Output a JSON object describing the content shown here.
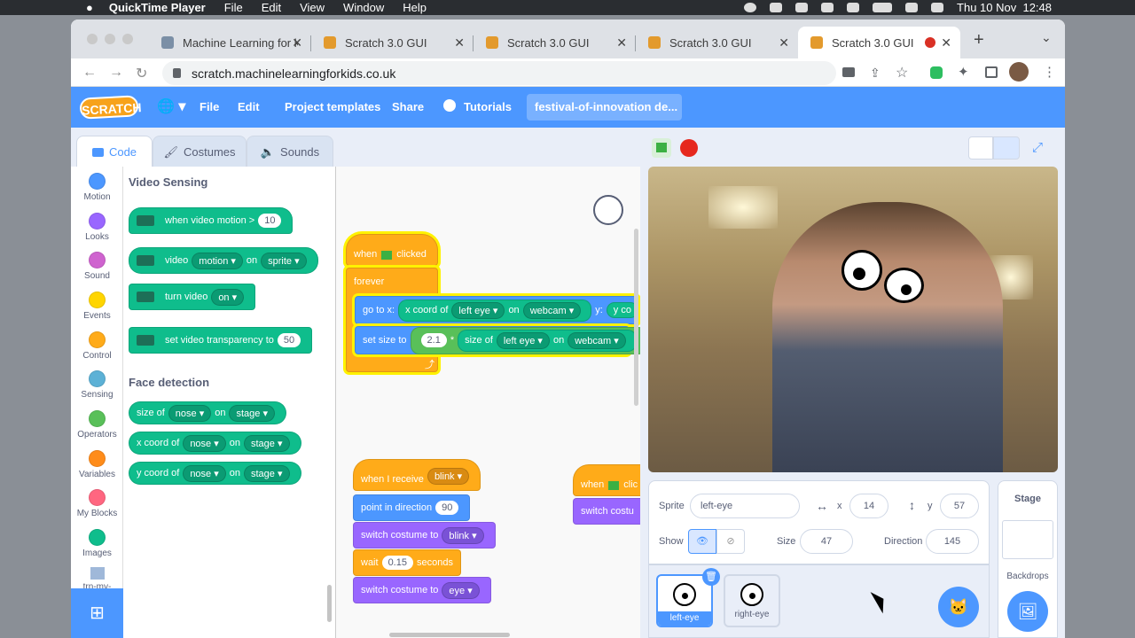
{
  "menubar": {
    "apple": "",
    "app": "QuickTime Player",
    "items": [
      "File",
      "Edit",
      "View",
      "Window",
      "Help"
    ],
    "clock": "Thu 10 Nov  12:48"
  },
  "browser": {
    "tabs": [
      {
        "title": "Machine Learning for k"
      },
      {
        "title": "Scratch 3.0 GUI"
      },
      {
        "title": "Scratch 3.0 GUI"
      },
      {
        "title": "Scratch 3.0 GUI"
      },
      {
        "title": "Scratch 3.0 GUI"
      }
    ],
    "new_tab": "+",
    "tab_menu": "⌄",
    "url": "scratch.machinelearningforkids.co.uk"
  },
  "scratch_menu": {
    "logo": "SCRATCH",
    "globe": "🌐 ▾",
    "file": "File",
    "edit": "Edit",
    "templates": "Project templates",
    "share": "Share",
    "tutorials": "Tutorials",
    "project_title": "festival-of-innovation de..."
  },
  "editor_tabs": {
    "code": "Code",
    "costumes": "Costumes",
    "sounds": "Sounds"
  },
  "categories": [
    {
      "label": "Motion",
      "color": "#4c97ff"
    },
    {
      "label": "Looks",
      "color": "#9966ff"
    },
    {
      "label": "Sound",
      "color": "#cf63cf"
    },
    {
      "label": "Events",
      "color": "#ffd500"
    },
    {
      "label": "Control",
      "color": "#ffab19"
    },
    {
      "label": "Sensing",
      "color": "#5cb1d6"
    },
    {
      "label": "Operators",
      "color": "#59c059"
    },
    {
      "label": "Variables",
      "color": "#ff8c1a"
    },
    {
      "label": "My Blocks",
      "color": "#ff6680"
    },
    {
      "label": "Images",
      "color": "#0fbd8c"
    },
    {
      "label": "trn-my-"
    }
  ],
  "palette": {
    "video_heading": "Video Sensing",
    "face_heading": "Face detection",
    "b1": {
      "text": "when video motion >",
      "value": "10"
    },
    "b2": {
      "text": "video",
      "dd1": "motion ▾",
      "on": "on",
      "dd2": "sprite ▾"
    },
    "b3": {
      "text": "turn video",
      "dd": "on ▾"
    },
    "b4": {
      "text": "set video transparency to",
      "value": "50"
    },
    "f1": {
      "text": "size of",
      "dd1": "nose ▾",
      "on": "on",
      "dd2": "stage ▾"
    },
    "f2": {
      "text": "x coord of",
      "dd1": "nose ▾",
      "on": "on",
      "dd2": "stage ▾"
    },
    "f3": {
      "text": "y coord of",
      "dd1": "nose ▾",
      "on": "on",
      "dd2": "stage ▾"
    }
  },
  "scripts": {
    "s1": {
      "hat": "when",
      "hat2": "clicked",
      "forever": "forever",
      "goto": "go to x:",
      "xcoord": "x coord of",
      "dd_eye": "left eye ▾",
      "on": "on",
      "dd_webcam": "webcam ▾",
      "y": "y:",
      "ycoord": "y co",
      "setsize": "set size to",
      "val": "2.1",
      "times": "*",
      "sizeof": "size of",
      "dd_eye2": "left eye ▾",
      "on2": "on",
      "dd_webcam2": "webcam ▾",
      "loop": "⤴"
    },
    "s2": {
      "hat": "when I receive",
      "dd": "blink ▾",
      "point": "point in direction",
      "dir": "90",
      "switch": "switch costume to",
      "dd2": "blink ▾",
      "wait": "wait",
      "wval": "0.15",
      "seconds": "seconds",
      "switch2": "switch costume to",
      "dd3": "eye ▾"
    },
    "s3": {
      "hat": "when",
      "hat2": "clic",
      "switch": "switch costu"
    }
  },
  "zoom": {
    "in": "+",
    "out": "−",
    "reset": "="
  },
  "sprite_info": {
    "sprite_label": "Sprite",
    "sprite_name": "left-eye",
    "x_label": "x",
    "x": "14",
    "y_label": "y",
    "y": "57",
    "show_label": "Show",
    "size_label": "Size",
    "size": "47",
    "direction_label": "Direction",
    "direction": "145"
  },
  "sprites": [
    {
      "name": "left-eye"
    },
    {
      "name": "right-eye"
    }
  ],
  "stage_pane": {
    "title": "Stage",
    "backdrops": "Backdrops"
  }
}
